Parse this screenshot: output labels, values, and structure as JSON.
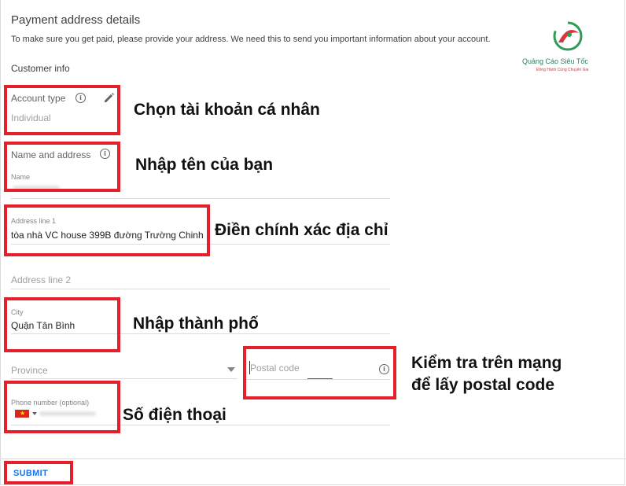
{
  "header": {
    "title": "Payment address details",
    "subtitle": "To make sure you get paid, please provide your address. We need this to send you important information about your account.",
    "section": "Customer info"
  },
  "logo": {
    "name": "Quảng Cáo Siêu Tốc",
    "tagline": "Đồng Hành Cùng Chuyên Gia"
  },
  "form": {
    "account_type": {
      "label": "Account type",
      "value": "Individual"
    },
    "name_address": {
      "label": "Name and address",
      "name_label": "Name"
    },
    "address_line1": {
      "label": "Address line 1",
      "value": "tòa nhà VC house 399B đường Trường Chinh"
    },
    "address_line2": {
      "placeholder": "Address line 2"
    },
    "city": {
      "label": "City",
      "value": "Quận Tân Bình"
    },
    "province": {
      "placeholder": "Province"
    },
    "postal_code": {
      "placeholder": "Postal code"
    },
    "phone": {
      "label": "Phone number (optional)"
    },
    "submit_label": "SUBMIT"
  },
  "annotations": {
    "account": "Chọn tài khoản cá nhân",
    "name": "Nhập tên của bạn",
    "address": "Điền chính xác địa chỉ",
    "city": "Nhập thành phố",
    "postal_1": "Kiểm tra trên mạng",
    "postal_2": "để lấy postal code",
    "phone": "Số điện thoại"
  },
  "colors": {
    "highlight": "#e5202c",
    "accent": "#1a73e8",
    "logo_green": "#2e9b57",
    "logo_red": "#d9363e"
  }
}
